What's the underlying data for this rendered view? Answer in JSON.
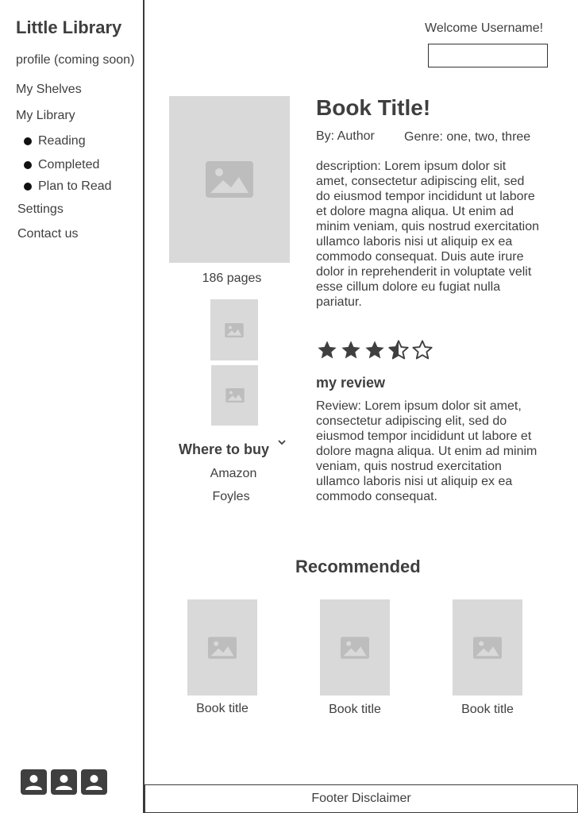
{
  "app": {
    "title": "Little Library"
  },
  "sidebar": {
    "profile": "profile (coming soon)",
    "my_shelves": "My Shelves",
    "my_library": "My Library",
    "library_items": [
      "Reading",
      "Completed",
      "Plan to Read"
    ],
    "settings": "Settings",
    "contact": "Contact us",
    "footer_icons": [
      "user-badge-icon",
      "user-badge-icon",
      "user-badge-icon"
    ]
  },
  "header": {
    "welcome": "Welcome Username!",
    "search": {
      "value": "",
      "placeholder": ""
    }
  },
  "book": {
    "title": "Book Title!",
    "author": "By: Author",
    "genre": "Genre: one, two, three",
    "pages": "186 pages",
    "description": "description: Lorem ipsum dolor sit amet, consectetur adipiscing elit, sed do eiusmod tempor incididunt ut labore et dolore magna aliqua. Ut enim ad minim veniam, quis nostrud exercitation ullamco laboris nisi ut aliquip ex ea commodo consequat. Duis aute irure dolor in reprehenderit in voluptate velit esse cillum dolore eu fugiat nulla pariatur.",
    "rating": 3.5,
    "rating_max": 5,
    "my_review_heading": "my review",
    "review": "Review: Lorem ipsum dolor sit amet, consectetur adipiscing elit, sed do eiusmod tempor incididunt ut labore et dolore magna aliqua. Ut enim ad minim veniam, quis nostrud exercitation ullamco laboris nisi ut aliquip ex ea commodo consequat."
  },
  "buy": {
    "title": "Where to buy",
    "stores": [
      "Amazon",
      "Foyles"
    ]
  },
  "recommended": {
    "title": "Recommended",
    "items": [
      {
        "label": "Book title"
      },
      {
        "label": "Book title"
      },
      {
        "label": "Book title"
      }
    ]
  },
  "footer": {
    "text": "Footer Disclaimer"
  },
  "colors": {
    "placeholder_bg": "#d9d9d9",
    "placeholder_icon": "#bdbdbd",
    "text": "#3f3f3f"
  }
}
